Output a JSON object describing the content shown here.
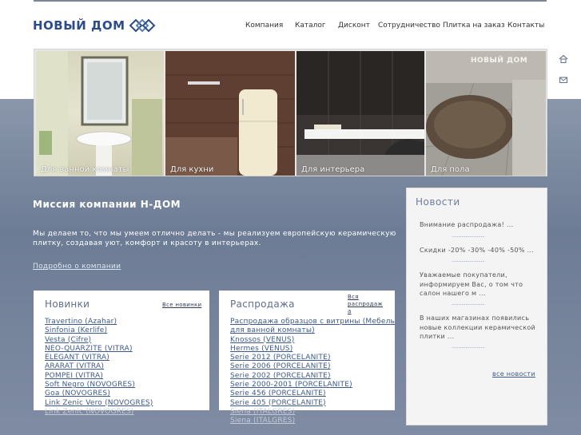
{
  "header": {
    "logo_text": "НОВЫЙ ДОМ",
    "nav": [
      "Компания",
      "Каталог",
      "Дисконт",
      "Сотрудничество",
      "Плитка на заказ",
      "Контакты"
    ],
    "side_icons": [
      "home-icon",
      "mail-icon"
    ]
  },
  "banner": {
    "panels": [
      {
        "label": "Для ванной комнаты"
      },
      {
        "label": "Для кухни"
      },
      {
        "label": "Для интерьера"
      },
      {
        "label": "Для пола"
      }
    ],
    "watermark": "НОВЫЙ ДОМ"
  },
  "mission": {
    "title": "Миссия компании Н-ДОМ",
    "text": "Мы делаем то, что мы умеем отлично делать - мы реализуем европейскую керамическую плитку, создавая уют, комфорт и красоту в интерьерах.",
    "link": "Подробно о компании"
  },
  "novelties": {
    "title": "Новинки",
    "all_link": "Все новинки",
    "items": [
      "Travertino (Azahar)",
      "Sinfonia (Kerlife)",
      "Vesta (Cifre)",
      "NEO-QUARZITE (VITRA)",
      "ELEGANT (VITRA)",
      "ARARAT (VITRA)",
      "POMPEI (VITRA)",
      "Soft Negro (NOVOGRES)",
      "Goa (NOVOGRES)",
      "Link Zenic Vero (NOVOGRES)",
      "Link Zenic (NOVOGRES)"
    ]
  },
  "sale": {
    "title": "Распродажа",
    "all_link_line1": "Вся распродаж",
    "all_link_line2": "а",
    "items": [
      "Распродажа образцов с витрины (Мебель",
      "для ванной комнаты)",
      "Knossos (VENUS)",
      "Hermes (VENUS)",
      "Serie 2012 (PORCELANITE)",
      "Serie 2006 (PORCELANITE)",
      "Serie 2002 (PORCELANITE)",
      "Serie 2000-2001 (PORCELANITE)",
      "Serie 456 (PORCELANITE)",
      "Serie 405 (PORCELANITE)",
      "Siena (ITALGRES)",
      "Siena (ITALGRES)"
    ]
  },
  "news": {
    "title": "Новости",
    "items": [
      "Внимание распродажа! ...",
      "Скидки -20% -30% -40% -50% ...",
      "Уважаемые покупатели, информируем Вас, о том что салон нашего м ...",
      "В наших магазинах появились новые коллекции керамической плитки ..."
    ],
    "separator": "........................",
    "all_link": "все новости"
  },
  "colors": {
    "brand": "#2b4c86",
    "band": "#7b889f",
    "link": "#3d5a8a"
  }
}
